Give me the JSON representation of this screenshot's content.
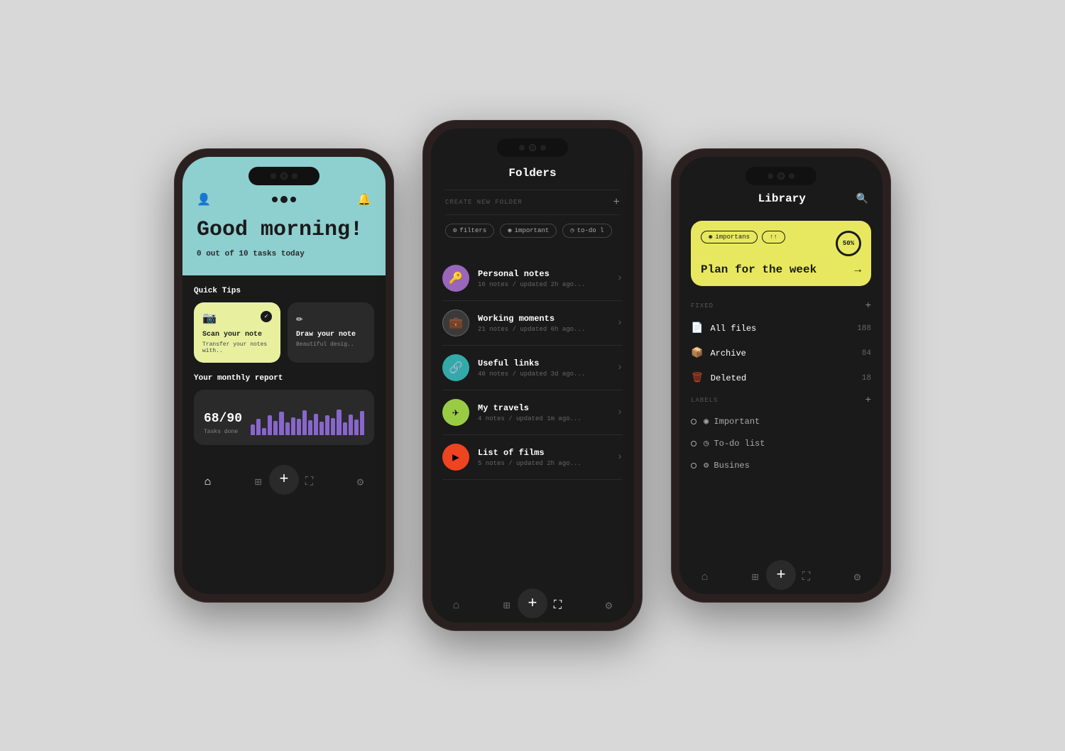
{
  "phone1": {
    "greeting": "Good morning!",
    "tasks_text": "0 out of",
    "tasks_count": "10",
    "tasks_suffix": "tasks today",
    "quick_tips_label": "Quick Tips",
    "tip1_title": "Scan your note",
    "tip1_sub": "Transfer your notes with..",
    "tip2_title": "Draw your note",
    "tip2_sub": "Beautiful desig..",
    "report_label": "Your monthly report",
    "report_number": "68/90",
    "report_tasks": "Tasks done",
    "bars": [
      30,
      45,
      20,
      55,
      40,
      65,
      35,
      50,
      45,
      70,
      42,
      60,
      38,
      55,
      48,
      72,
      35,
      58,
      44,
      68
    ]
  },
  "phone2": {
    "title": "Folders",
    "create_label": "CREATE NEW FOLDER",
    "filters": [
      {
        "label": "filters",
        "icon": "⚙"
      },
      {
        "label": "important",
        "icon": "◉"
      },
      {
        "label": "to-do l",
        "icon": "◷"
      }
    ],
    "folders": [
      {
        "name": "Personal notes",
        "meta": "16 notes / updated 2h ago...",
        "color": "#9966bb",
        "icon": "🔑"
      },
      {
        "name": "Working moments",
        "meta": "21 notes / updated 6h ago...",
        "color": "#cccccc",
        "icon": "💼"
      },
      {
        "name": "Useful links",
        "meta": "40 notes / updated 3d ago...",
        "color": "#44cccc",
        "icon": "🔗"
      },
      {
        "name": "My travels",
        "meta": "4 notes / updated 1m ago...",
        "color": "#99cc44",
        "icon": "✈"
      },
      {
        "name": "List of films",
        "meta": "5 notes / updated 2h ago...",
        "color": "#ee5533",
        "icon": "▶"
      }
    ]
  },
  "phone3": {
    "title": "Library",
    "featured_chip1": "importans",
    "featured_chip2": "↑↑",
    "featured_progress": "50%",
    "featured_title": "Plan for the week",
    "fixed_label": "FIXED",
    "items": [
      {
        "icon": "📄",
        "name": "All files",
        "count": "188",
        "color": "#cc4422"
      },
      {
        "icon": "📦",
        "name": "Archive",
        "count": "84",
        "color": "#44aa44"
      },
      {
        "icon": "🗑",
        "name": "Deleted",
        "count": "18",
        "color": "#cc4422"
      }
    ],
    "labels_label": "LABELS",
    "labels": [
      {
        "name": "Important",
        "icon": "◉"
      },
      {
        "name": "To-do list",
        "icon": "◷"
      },
      {
        "name": "Busines",
        "icon": "⚙"
      }
    ]
  }
}
